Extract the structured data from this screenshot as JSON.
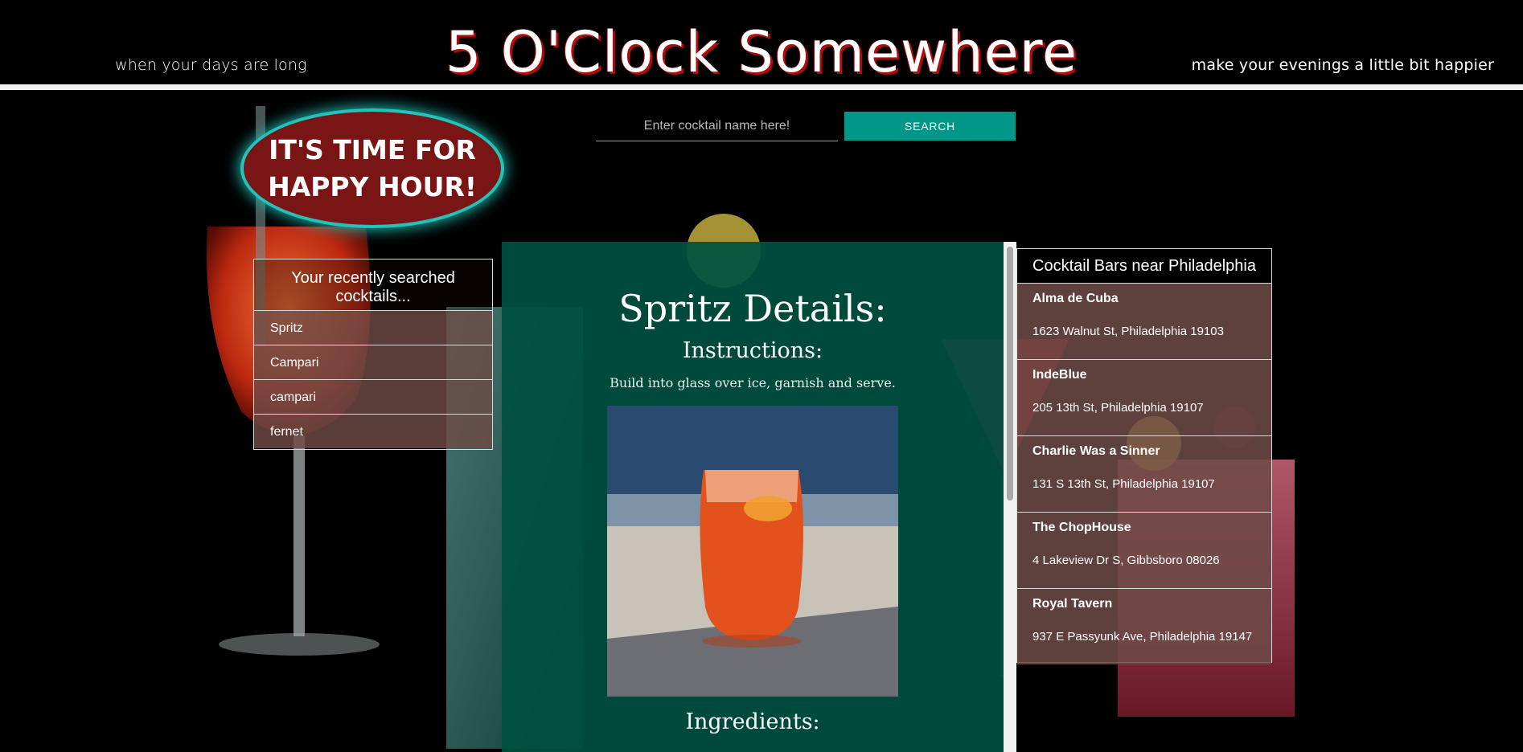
{
  "header": {
    "tagline_left": "when your days are long",
    "title": "5 O'Clock Somewhere",
    "tagline_right": "make your evenings a little bit happier"
  },
  "search": {
    "placeholder": "Enter cocktail name here!",
    "button_label": "SEARCH"
  },
  "badge": {
    "line1": "IT'S TIME FOR",
    "line2": "HAPPY HOUR!"
  },
  "recent": {
    "title": "Your recently searched cocktails...",
    "items": [
      "Spritz",
      "Campari",
      "campari",
      "fernet"
    ]
  },
  "details": {
    "title": "Spritz Details:",
    "instructions_heading": "Instructions:",
    "instructions": "Build into glass over ice, garnish and serve.",
    "ingredients_heading": "Ingredients:"
  },
  "bars": {
    "title": "Cocktail Bars near Philadelphia",
    "items": [
      {
        "name": "Alma de Cuba",
        "address": "1623 Walnut St, Philadelphia 19103"
      },
      {
        "name": "IndeBlue",
        "address": "205 13th St, Philadelphia 19107"
      },
      {
        "name": "Charlie Was a Sinner",
        "address": "131 S 13th St, Philadelphia 19107"
      },
      {
        "name": "The ChopHouse",
        "address": "4 Lakeview Dr S, Gibbsboro 08026"
      },
      {
        "name": "Royal Tavern",
        "address": "937 E Passyunk Ave, Philadelphia 19147"
      }
    ]
  },
  "colors": {
    "accent": "#009688",
    "badge_fill": "#7a1515",
    "badge_glow": "#22c3bb",
    "details_panel": "#005040",
    "title_shadow": "#b50a0a"
  }
}
